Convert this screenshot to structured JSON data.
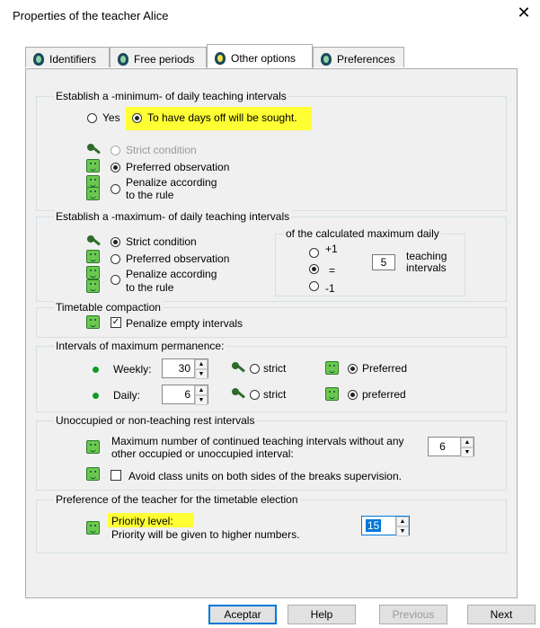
{
  "window": {
    "title": "Properties of the teacher Alice",
    "close_glyph": "✕"
  },
  "tabs": [
    {
      "label": "Identifiers"
    },
    {
      "label": "Free periods"
    },
    {
      "label": "Other options"
    },
    {
      "label": "Preferences"
    }
  ],
  "min_group": {
    "legend": "Establish a -minimum- of daily teaching intervals",
    "yes": "Yes",
    "days_off": "To have days off will be sought.",
    "strict": "Strict condition",
    "preferred": "Preferred observation",
    "penalize_1": "Penalize according",
    "penalize_2": "to the rule"
  },
  "max_group": {
    "legend": "Establish a -maximum- of daily teaching intervals",
    "strict": "Strict condition",
    "preferred": "Preferred observation",
    "penalize_1": "Penalize according",
    "penalize_2": "to the rule",
    "calc_legend": "of the calculated maximum daily",
    "plus": "+1",
    "equal": "=",
    "minus": "-1",
    "value": "5",
    "teaching": "teaching",
    "intervals": "intervals"
  },
  "compaction": {
    "legend": "Timetable compaction",
    "penalize_empty": "Penalize empty intervals"
  },
  "permanence": {
    "legend": "Intervals of maximum permanence:",
    "weekly_label": "Weekly:",
    "weekly_value": "30",
    "daily_label": "Daily:",
    "daily_value": "6",
    "strict": "strict",
    "preferred_weekly": "Preferred",
    "preferred_daily": "preferred"
  },
  "rest": {
    "legend": "Unoccupied or non-teaching rest intervals",
    "max_line1": "Maximum number of continued teaching intervals without any",
    "max_line2": "other occupied or unoccupied interval:",
    "max_value": "6",
    "avoid": "Avoid class units on both sides of the breaks supervision."
  },
  "preference": {
    "legend": "Preference of the teacher for the timetable election",
    "priority": "Priority level:",
    "priority_note": "Priority will be given to higher numbers.",
    "priority_value": "15"
  },
  "buttons": {
    "accept": "Aceptar",
    "help": "Help",
    "previous": "Previous",
    "next": "Next"
  },
  "colors": {
    "highlight": "#ffff33",
    "group_border": "#d5dfe5",
    "accent_blue": "#0078d7",
    "smile_green": "#6bc94e",
    "bullet_green": "#119a28"
  }
}
